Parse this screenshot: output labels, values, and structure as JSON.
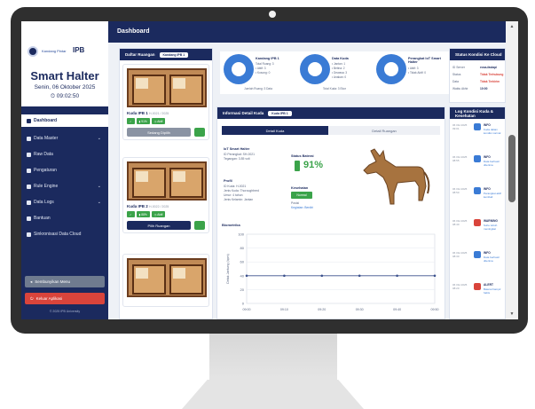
{
  "sidebar": {
    "logo_text": "Kandang Pintar",
    "logo_ipb": "IPB",
    "app_title": "Smart Halter",
    "date": "Senin, 06 Oktober 2025",
    "time": "⏲ 09:02:50",
    "nav": [
      {
        "label": "Dashboard",
        "active": true
      },
      {
        "label": "Data Master",
        "chevron": true
      },
      {
        "label": "Raw Data"
      },
      {
        "label": "Pengaturan"
      },
      {
        "label": "Rule Engine",
        "chevron": true
      },
      {
        "label": "Data Logs",
        "chevron": true
      },
      {
        "label": "Bantuan"
      },
      {
        "label": "Sinkronisasi Data Cloud"
      }
    ],
    "hide_menu_label": "Sembunyikan Menu",
    "exit_label": "Keluar Aplikasi",
    "copyright": "© 2025 IPB University"
  },
  "topbar": {
    "title": "Dashboard"
  },
  "kandang": {
    "title": "Daftar Ruangan",
    "filter": "Kandang IPB 1",
    "cards": [
      {
        "name": "Kuda IPB 1",
        "sub": "H-0021 / 2025",
        "tags": [
          "✓",
          "▮ 91%",
          "◷ Aktif"
        ],
        "button": "Sedang Dipilih",
        "button_style": "gray"
      },
      {
        "name": "Kuda IPB 2",
        "sub": "H-0022 / 2025",
        "tags": [
          "✓",
          "▮ 88%",
          "◷ Aktif"
        ],
        "button": "Pilih Ruangan",
        "button_style": "navy"
      }
    ]
  },
  "stats": [
    {
      "title": "Kandang IPB 1",
      "lines": [
        "Total Ruang: 3",
        "• Aktif: 3",
        "• Kosong: 0"
      ],
      "foot": "Jumlah Ruang: 3 Data"
    },
    {
      "title": "Data Kuda",
      "lines": [
        "• Jantan: 1",
        "• Betina: 2",
        "• Dewasa: 3",
        "• Anakan: 0"
      ],
      "foot": "Total Kuda: 3 Ekor"
    },
    {
      "title": "Perangkat IoT Smart Halter",
      "lines": [
        "• Aktif: 3",
        "• Tidak Aktif: 0"
      ],
      "foot": ""
    }
  ],
  "info": {
    "title": "Informasi Detail Kuda",
    "badge": "Kuda IPB 1",
    "tabs": [
      "Detail Kuda",
      "Detail Ruangan"
    ],
    "device_head": "IoT Smart Halter",
    "device_lines": [
      "ID Perangkat: SH-0021",
      "Tegangan: 3.85 volt"
    ],
    "battery_head": "Status Baterai",
    "battery_value": "91%",
    "profile_head": "Profil",
    "profile_lines": [
      "ID Kuda: H-0021",
      "Jenis Kuda: Thoroughbred",
      "Umur: 4 tahun",
      "Jenis Kelamin: Jantan"
    ],
    "status_head": "Kesehatan",
    "status_value": "Normal",
    "location_lines": [
      "Posisi",
      "Kegiatan: Berdiri"
    ]
  },
  "chart_data": {
    "type": "line",
    "title": "Biometrika",
    "ylabel": "Detak Jantung (bpm)",
    "x": [
      "09:00",
      "09:10",
      "09:20",
      "09:30",
      "09:40",
      "09:50"
    ],
    "series": [
      {
        "values": [
          40,
          40,
          40,
          40,
          40,
          40
        ]
      }
    ],
    "ylim": [
      0,
      100
    ],
    "yticks": [
      0,
      20,
      40,
      60,
      80,
      100
    ]
  },
  "status_panel": {
    "title": "Status Kondisi Ke Cloud",
    "rows": [
      {
        "key": "ID Server",
        "value": "ecsa-fastapi",
        "color": "#1b2a5e"
      },
      {
        "key": "Status",
        "value": "Tidak Terhubung",
        "color": "#d9443b"
      },
      {
        "key": "Data",
        "value": "Tidak Terkirim",
        "color": "#d9443b"
      },
      {
        "key": "Waktu Akhir",
        "value": "10:00",
        "color": "#1b2a5e"
      }
    ]
  },
  "log_panel": {
    "title": "Log Kondisi Kuda & Kesehatan",
    "entries": [
      {
        "time": "06 Okt 2025 09:01",
        "title": "INFO",
        "desc": "Kuda dalam kondisi normal",
        "color": "#3a7bd5"
      },
      {
        "time": "06 Okt 2025 08:55",
        "title": "INFO",
        "desc": "Data berhasil diterima",
        "color": "#3a7bd5"
      },
      {
        "time": "06 Okt 2025 08:50",
        "title": "INFO",
        "desc": "Perangkat aktif kembali",
        "color": "#3a7bd5"
      },
      {
        "time": "06 Okt 2025 08:40",
        "title": "WARNING",
        "desc": "Suhu tubuh meningkat",
        "color": "#d9443b"
      },
      {
        "time": "06 Okt 2025 08:30",
        "title": "INFO",
        "desc": "Data berhasil diterima",
        "color": "#3a7bd5"
      },
      {
        "time": "06 Okt 2025 08:20",
        "title": "ALERT",
        "desc": "Baterai hampir habis",
        "color": "#d9443b"
      }
    ]
  }
}
